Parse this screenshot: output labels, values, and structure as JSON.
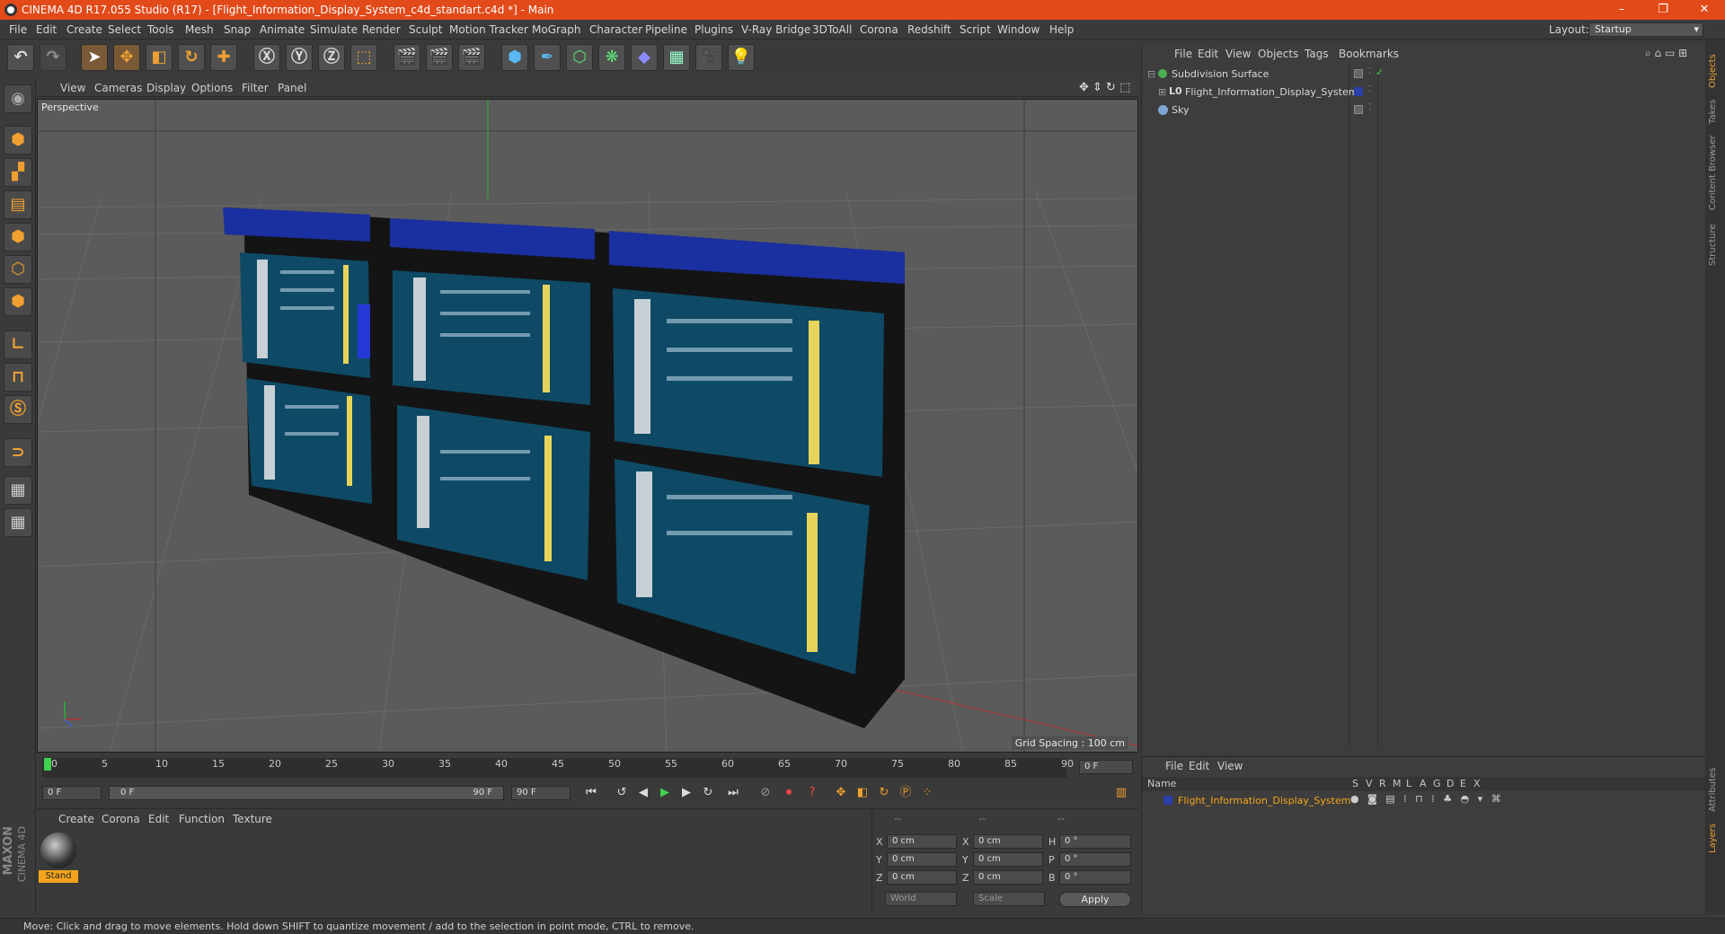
{
  "window": {
    "title": "CINEMA 4D R17.055 Studio (R17) - [Flight_Information_Display_System_c4d_standart.c4d *] - Main",
    "controls": [
      "–",
      "❐",
      "✕"
    ]
  },
  "menubar": {
    "items": [
      "File",
      "Edit",
      "Create",
      "Select",
      "Tools",
      "Mesh",
      "Snap",
      "Animate",
      "Simulate",
      "Render",
      "Sculpt",
      "Motion Tracker",
      "MoGraph",
      "Character",
      "Pipeline",
      "Plugins",
      "V-Ray Bridge",
      "3DToAll",
      "Corona",
      "Redshift",
      "Script",
      "Window",
      "Help"
    ],
    "layout_label": "Layout:",
    "layout_value": "Startup"
  },
  "viewport": {
    "menu": [
      "View",
      "Cameras",
      "Display",
      "Options",
      "Filter",
      "Panel"
    ],
    "label": "Perspective",
    "grid_spacing": "Grid Spacing : 100 cm"
  },
  "timeline": {
    "ticks": [
      "0",
      "5",
      "10",
      "15",
      "20",
      "25",
      "30",
      "35",
      "40",
      "45",
      "50",
      "55",
      "60",
      "65",
      "70",
      "75",
      "80",
      "85",
      "90"
    ],
    "frame_field": "0 F",
    "start": "0 F",
    "slider_left": "0 F",
    "slider_right": "90 F",
    "end": "90 F"
  },
  "material_manager": {
    "menu": [
      "Create",
      "Corona",
      "Edit",
      "Function",
      "Texture"
    ],
    "material_name": "Stand"
  },
  "coordinates": {
    "header": [
      "--",
      "--",
      "--"
    ],
    "rows": [
      {
        "axis": "X",
        "pos": "0 cm",
        "axis2": "X",
        "size": "0 cm",
        "rlabel": "H",
        "rot": "0 °"
      },
      {
        "axis": "Y",
        "pos": "0 cm",
        "axis2": "Y",
        "size": "0 cm",
        "rlabel": "P",
        "rot": "0 °"
      },
      {
        "axis": "Z",
        "pos": "0 cm",
        "axis2": "Z",
        "size": "0 cm",
        "rlabel": "B",
        "rot": "0 °"
      }
    ],
    "world": "World",
    "scale": "Scale",
    "apply": "Apply"
  },
  "object_manager": {
    "menu": [
      "File",
      "Edit",
      "View",
      "Objects",
      "Tags",
      "Bookmarks"
    ],
    "objects": [
      {
        "name": "Subdivision Surface",
        "color": "#4caf50"
      },
      {
        "name": "Flight_Information_Display_System",
        "color": "#2b3fa8"
      },
      {
        "name": "Sky",
        "color": "#7fa7d4"
      }
    ]
  },
  "layer_manager": {
    "menu": [
      "File",
      "Edit",
      "View"
    ],
    "columns": [
      "Name",
      "S",
      "V",
      "R",
      "M",
      "L",
      "A",
      "G",
      "D",
      "E",
      "X"
    ],
    "layer_name": "Flight_Information_Display_System"
  },
  "right_tabs": [
    "Objects",
    "Takes",
    "Content Browser",
    "Structure"
  ],
  "right_tabs_lower": [
    "Attributes",
    "Layers"
  ],
  "status": "Move: Click and drag to move elements. Hold down SHIFT to quantize movement / add to the selection in point mode, CTRL to remove.",
  "branding": [
    "MAXON",
    "CINEMA 4D"
  ],
  "colors": {
    "titlebar": "#e24a1a",
    "accent": "#f0a030",
    "selection": "#f3a41c"
  }
}
